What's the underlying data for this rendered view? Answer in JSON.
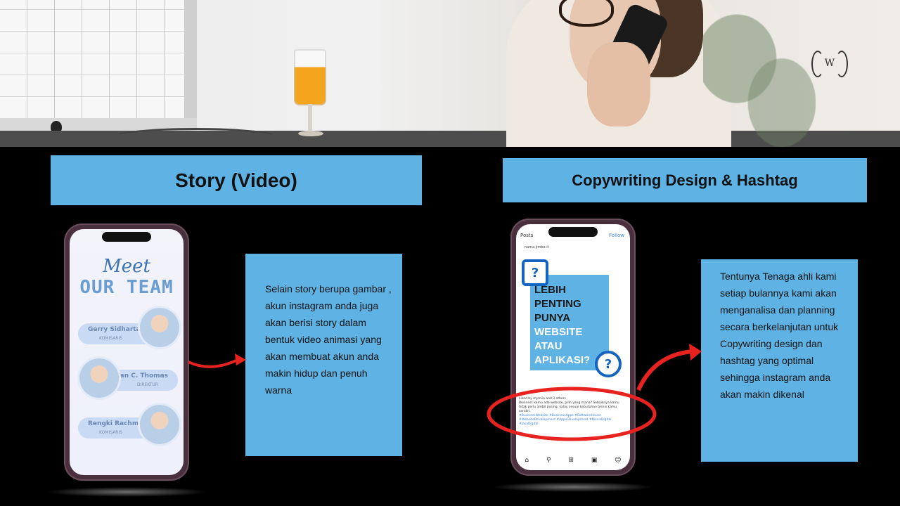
{
  "photo": {
    "logo_letter": "W"
  },
  "left": {
    "title": "Story (Video)",
    "phone": {
      "meet": "Meet",
      "our_team": "OUR TEAM",
      "members": [
        {
          "name": "Gerry Sidharta",
          "role": "KOMISARIS"
        },
        {
          "name": "Brian C. Thomas",
          "role": "DIREKTUR"
        },
        {
          "name": "Rengki Rachmat Jaya",
          "role": "KOMISARIS"
        }
      ]
    },
    "description": "Selain story berupa gambar , akun instagram anda juga akan berisi story dalam bentuk video animasi yang akan membuat  akun anda makin hidup dan penuh warna"
  },
  "right": {
    "title": "Copywriting Design & Hashtag",
    "phone": {
      "back_label": "Posts",
      "follow_label": "Follow",
      "username": "nama.jimbe.it",
      "post_line1": "LEBIH",
      "post_line2": "PENTING",
      "post_line3": "PUNYA",
      "post_line4": "WEBSITE",
      "post_line5": "ATAU",
      "post_line6": "APLIKASI?",
      "liked_by": "Liked by mymiia and 3 others",
      "caption": "Business kamu ada website, pilih yang mana? Sebaiknya kamu tidak perlu ambil pusing, kalau sesuai kebutuhan bisnis kamu sendiri.",
      "hashtags": "#BusinessWebsite #BusinessApps #SoftwareHouse #WebsiteDevelopment #AppsDevelopment #BisnisDigital #JasaDigital"
    },
    "description": "Tentunya Tenaga ahli kami setiap bulannya kami akan menganalisa dan planning secara berkelanjutan untuk Copywriting design dan hashtag yang optimal sehingga instagram anda akan makin dikenal"
  },
  "colors": {
    "accent_blue": "#5eb3e4",
    "arrow_red": "#e8231f",
    "background": "#000000"
  }
}
